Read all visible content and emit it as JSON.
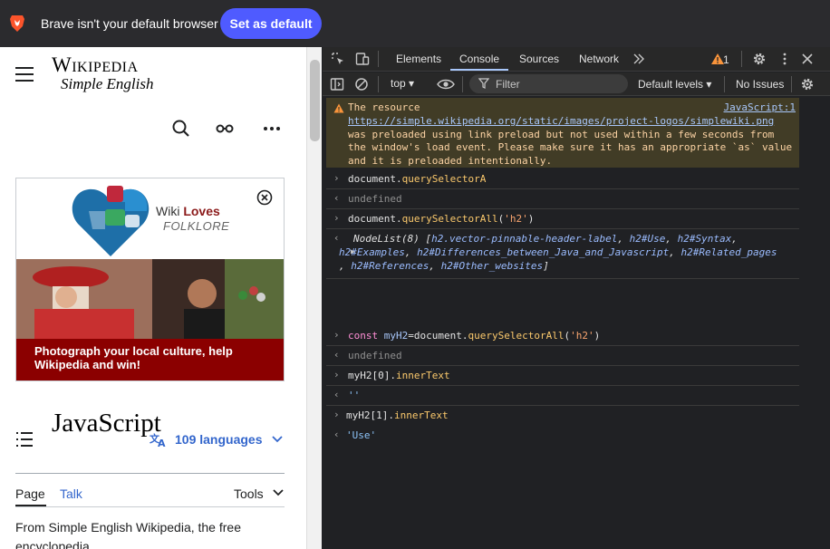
{
  "brave_bar": {
    "message": "Brave isn't your default browser",
    "set_default_label": "Set as default"
  },
  "wiki": {
    "wordmark": "Wikipedia",
    "tagline": "Simple English",
    "banner": {
      "wiki_text": "Wiki",
      "loves_text": "Loves",
      "folklore_text": "FOLKLORE",
      "caption": "Photograph your local culture, help Wikipedia and win!"
    },
    "page_title": "JavaScript",
    "languages_label": "109 languages",
    "tabs": {
      "page": "Page",
      "talk": "Talk",
      "tools": "Tools"
    },
    "from_line": "From Simple English Wikipedia, the free encyclopedia"
  },
  "devtools": {
    "tabs": [
      "Elements",
      "Console",
      "Sources",
      "Network"
    ],
    "active_tab": "Console",
    "warning_count": "1",
    "context": "top",
    "filter_placeholder": "Filter",
    "levels_label": "Default levels",
    "issues_label": "No Issues",
    "warning": {
      "prefix": "The resource",
      "url": "https://simple.wikipedia.org/static/images/project-logos/simplewiki.png",
      "suffix": "was preloaded using link preload but not used within a few seconds from the window's load event. Please make sure it has an appropriate `as` value and it is preloaded intentionally.",
      "source": "JavaScript:1"
    },
    "console": {
      "cmd1_obj": "document.",
      "cmd1_method": "querySelectorA",
      "res1": "undefined",
      "cmd2_obj": "document.",
      "cmd2_method": "querySelectorAll",
      "cmd2_arg": "'h2'",
      "nodelist_head": "NodeList(8) [",
      "nodelist_items": [
        "h2.vector-pinnable-header-label",
        "h2#Use",
        "h2#Syntax",
        "h2#Examples",
        "h2#Differences_between_Java_and_Javascript",
        "h2#Related_pages",
        "h2#References",
        "h2#Other_websites"
      ],
      "cmd3_kw": "const",
      "cmd3_var": "myH2",
      "cmd3_rest": "=document.",
      "cmd3_method": "querySelectorAll",
      "cmd3_arg": "'h2'",
      "res3": "undefined",
      "cmd4": "myH2[0].",
      "cmd4_prop": "innerText",
      "res4": "''",
      "cmd5": "myH2[1].",
      "cmd5_prop": "innerText",
      "res5": "'Use'"
    }
  }
}
